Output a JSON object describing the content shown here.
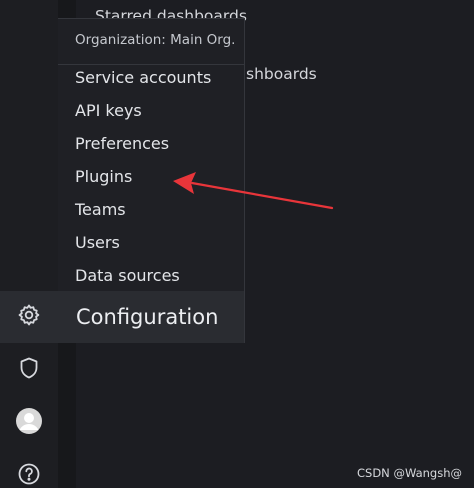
{
  "background": {
    "starred_dashboards": "Starred dashboards",
    "dashboards_partial": "shboards"
  },
  "menu": {
    "header": "Organization: Main Org.",
    "items": [
      {
        "label": "Service accounts"
      },
      {
        "label": "API keys"
      },
      {
        "label": "Preferences"
      },
      {
        "label": "Plugins"
      },
      {
        "label": "Teams"
      },
      {
        "label": "Users"
      },
      {
        "label": "Data sources"
      }
    ],
    "footer_label": "Configuration"
  },
  "sidebar": {
    "icons": [
      "gear-icon",
      "shield-icon",
      "avatar",
      "help-icon"
    ]
  },
  "annotation": {
    "arrow_color": "#e8353a"
  },
  "watermark": "CSDN @Wangsh@"
}
